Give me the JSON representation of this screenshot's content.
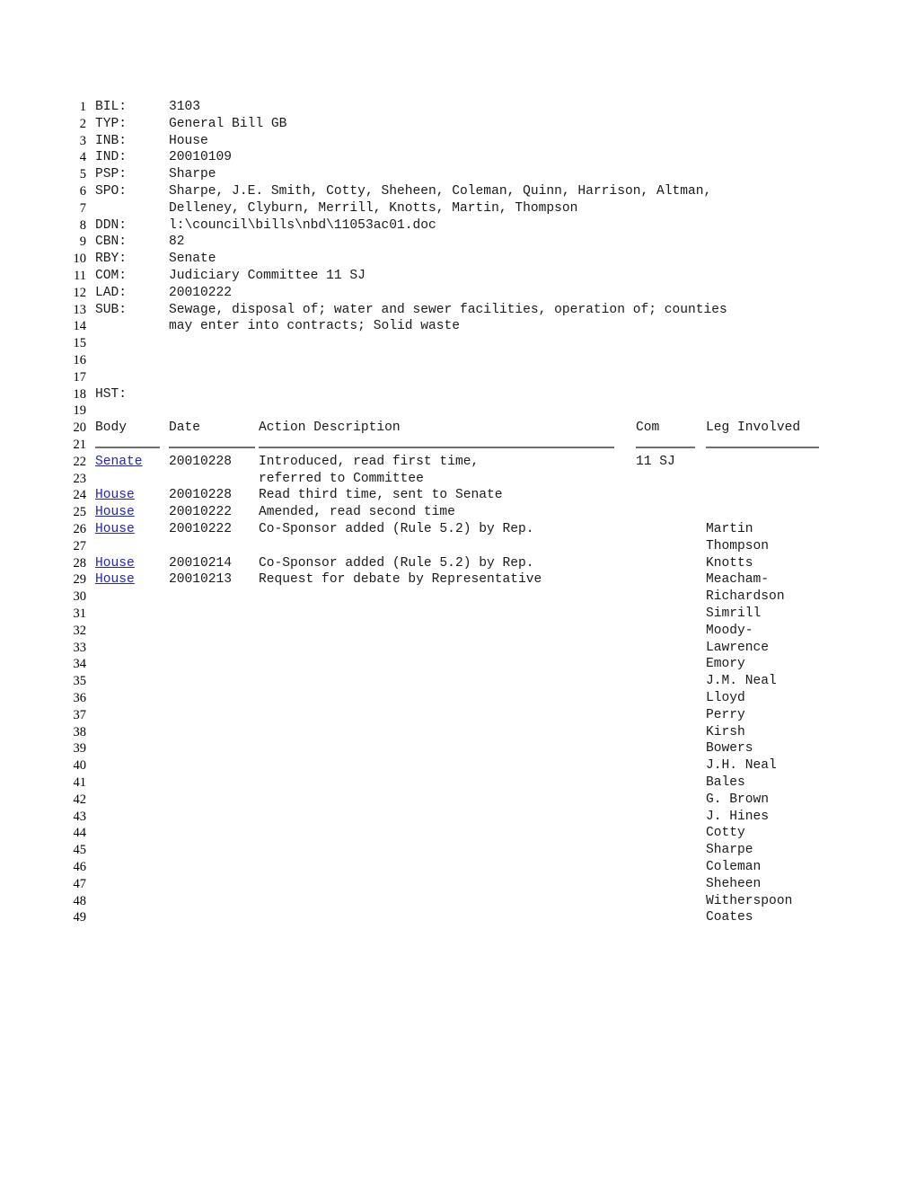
{
  "document": {
    "fields": [
      {
        "line": 1,
        "label": "BIL:",
        "value": "3103"
      },
      {
        "line": 2,
        "label": "TYP:",
        "value": "General Bill GB"
      },
      {
        "line": 3,
        "label": "INB:",
        "value": "House"
      },
      {
        "line": 4,
        "label": "IND:",
        "value": "20010109"
      },
      {
        "line": 5,
        "label": "PSP:",
        "value": "Sharpe"
      },
      {
        "line": 6,
        "label": "SPO:",
        "value": "Sharpe, J.E. Smith, Cotty, Sheheen, Coleman, Quinn, Harrison, Altman,"
      },
      {
        "line": 7,
        "label": "",
        "value": "Delleney, Clyburn, Merrill, Knotts, Martin, Thompson"
      },
      {
        "line": 8,
        "label": "DDN:",
        "value": "l:\\council\\bills\\nbd\\11053ac01.doc"
      },
      {
        "line": 9,
        "label": "CBN:",
        "value": "82"
      },
      {
        "line": 10,
        "label": "RBY:",
        "value": "Senate"
      },
      {
        "line": 11,
        "label": "COM:",
        "value": "Judiciary Committee 11 SJ"
      },
      {
        "line": 12,
        "label": "LAD:",
        "value": "20010222"
      },
      {
        "line": 13,
        "label": "SUB:",
        "value": "Sewage, disposal of; water and sewer facilities, operation of; counties"
      },
      {
        "line": 14,
        "label": "",
        "value": "may enter into contracts; Solid waste"
      },
      {
        "line": 15,
        "label": "",
        "value": ""
      },
      {
        "line": 16,
        "label": "",
        "value": ""
      },
      {
        "line": 17,
        "label": "",
        "value": ""
      },
      {
        "line": 18,
        "label": "HST:",
        "value": ""
      },
      {
        "line": 19,
        "label": "",
        "value": ""
      }
    ],
    "history_section_label": "HST:",
    "table": {
      "header_line": 20,
      "rule_line": 21,
      "columns": {
        "body": "Body",
        "date": "Date",
        "action": "Action Description",
        "com": "Com",
        "leg": "Leg Involved"
      },
      "rows": [
        {
          "line": 22,
          "body": "Senate",
          "body_link": true,
          "date": "20010228",
          "action": "Introduced, read first time,",
          "com": "11 SJ",
          "leg": ""
        },
        {
          "line": 23,
          "body": "",
          "body_link": false,
          "date": "",
          "action": "referred to Committee",
          "com": "",
          "leg": ""
        },
        {
          "line": 24,
          "body": "House",
          "body_link": true,
          "date": "20010228",
          "action": "Read third time, sent to Senate",
          "com": "",
          "leg": ""
        },
        {
          "line": 25,
          "body": "House",
          "body_link": true,
          "date": "20010222",
          "action": "Amended, read second time",
          "com": "",
          "leg": ""
        },
        {
          "line": 26,
          "body": "House",
          "body_link": true,
          "date": "20010222",
          "action": "Co-Sponsor added (Rule 5.2) by Rep.",
          "com": "",
          "leg": "Martin"
        },
        {
          "line": 27,
          "body": "",
          "body_link": false,
          "date": "",
          "action": "",
          "com": "",
          "leg": "Thompson"
        },
        {
          "line": 28,
          "body": "House",
          "body_link": true,
          "date": "20010214",
          "action": "Co-Sponsor added (Rule 5.2) by Rep.",
          "com": "",
          "leg": "Knotts"
        },
        {
          "line": 29,
          "body": "House",
          "body_link": true,
          "date": "20010213",
          "action": "Request for debate by Representative",
          "com": "",
          "leg": "Meacham-"
        },
        {
          "line": 30,
          "body": "",
          "body_link": false,
          "date": "",
          "action": "",
          "com": "",
          "leg": "Richardson"
        },
        {
          "line": 31,
          "body": "",
          "body_link": false,
          "date": "",
          "action": "",
          "com": "",
          "leg": "Simrill"
        },
        {
          "line": 32,
          "body": "",
          "body_link": false,
          "date": "",
          "action": "",
          "com": "",
          "leg": "Moody-"
        },
        {
          "line": 33,
          "body": "",
          "body_link": false,
          "date": "",
          "action": "",
          "com": "",
          "leg": "Lawrence"
        },
        {
          "line": 34,
          "body": "",
          "body_link": false,
          "date": "",
          "action": "",
          "com": "",
          "leg": "Emory"
        },
        {
          "line": 35,
          "body": "",
          "body_link": false,
          "date": "",
          "action": "",
          "com": "",
          "leg": "J.M. Neal"
        },
        {
          "line": 36,
          "body": "",
          "body_link": false,
          "date": "",
          "action": "",
          "com": "",
          "leg": "Lloyd"
        },
        {
          "line": 37,
          "body": "",
          "body_link": false,
          "date": "",
          "action": "",
          "com": "",
          "leg": "Perry"
        },
        {
          "line": 38,
          "body": "",
          "body_link": false,
          "date": "",
          "action": "",
          "com": "",
          "leg": "Kirsh"
        },
        {
          "line": 39,
          "body": "",
          "body_link": false,
          "date": "",
          "action": "",
          "com": "",
          "leg": "Bowers"
        },
        {
          "line": 40,
          "body": "",
          "body_link": false,
          "date": "",
          "action": "",
          "com": "",
          "leg": "J.H. Neal"
        },
        {
          "line": 41,
          "body": "",
          "body_link": false,
          "date": "",
          "action": "",
          "com": "",
          "leg": "Bales"
        },
        {
          "line": 42,
          "body": "",
          "body_link": false,
          "date": "",
          "action": "",
          "com": "",
          "leg": "G. Brown"
        },
        {
          "line": 43,
          "body": "",
          "body_link": false,
          "date": "",
          "action": "",
          "com": "",
          "leg": "J. Hines"
        },
        {
          "line": 44,
          "body": "",
          "body_link": false,
          "date": "",
          "action": "",
          "com": "",
          "leg": "Cotty"
        },
        {
          "line": 45,
          "body": "",
          "body_link": false,
          "date": "",
          "action": "",
          "com": "",
          "leg": "Sharpe"
        },
        {
          "line": 46,
          "body": "",
          "body_link": false,
          "date": "",
          "action": "",
          "com": "",
          "leg": "Coleman"
        },
        {
          "line": 47,
          "body": "",
          "body_link": false,
          "date": "",
          "action": "",
          "com": "",
          "leg": "Sheheen"
        },
        {
          "line": 48,
          "body": "",
          "body_link": false,
          "date": "",
          "action": "",
          "com": "",
          "leg": "Witherspoon"
        },
        {
          "line": 49,
          "body": "",
          "body_link": false,
          "date": "",
          "action": "",
          "com": "",
          "leg": "Coates"
        }
      ]
    },
    "colors": {
      "link": "#2222cc",
      "text": "#1a1a1a",
      "rule": "#707070",
      "background": "#ffffff"
    }
  }
}
